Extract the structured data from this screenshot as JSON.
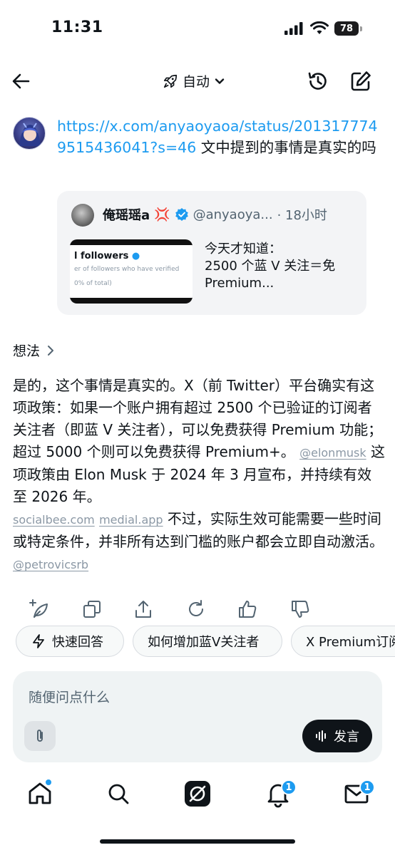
{
  "status_bar": {
    "time": "11:31",
    "battery": "78",
    "icons": [
      "signal-icon",
      "wifi-icon",
      "battery-icon"
    ]
  },
  "header": {
    "mode_label": "自动",
    "icons": [
      "back-arrow-icon",
      "rocket-icon",
      "chevron-down-icon",
      "history-icon",
      "compose-icon"
    ]
  },
  "user_message": {
    "link": "https://x.com/anyaoyaoa/status/2013177749515436041?s=46",
    "text": " 文中提到的事情是真实的吗"
  },
  "quoted_post": {
    "name": "俺瑶瑶a",
    "handle": "@anyaoya...",
    "time": "· 18小时",
    "thumbnail_title": "l followers",
    "thumbnail_sub": "er of followers who have verified",
    "thumbnail_foot": "0% of total)",
    "text_line1": "今天才知道：",
    "text_line2": "2500 个蓝 V 关注＝免",
    "text_line3": "Premium..."
  },
  "thoughts_label": "想法",
  "answer": {
    "p1": "是的，这个事情是真实的。X（前 Twitter）平台确实有这项政策：如果一个账户拥有超过 2500 个已验证的订阅者关注者（即蓝 V 关注者），可以免费获得 Premium 功能；超过 5000 个则可以免费获得 Premium+。 ",
    "cite1": "@elonmusk",
    "p2": " 这项政策由 Elon Musk 于 2024 年 3 月宣布，并持续有效至 2026 年。",
    "cite2": "socialbee.com",
    "cite3": "medial.app",
    "p3": " 不过，实际生效可能需要一些时间或特定条件，并非所有达到门槛的账户都会立即自动激活。 ",
    "cite4": "@petrovicsrb"
  },
  "action_icons": [
    "sparkle-leaf-icon",
    "copy-icon",
    "share-icon",
    "regenerate-icon",
    "thumbs-up-icon",
    "thumbs-down-icon"
  ],
  "chips": {
    "quick": "快速回答",
    "c2": "如何增加蓝V关注者",
    "c3": "X Premium订阅"
  },
  "composer": {
    "placeholder": "随便问点什么",
    "speak_label": "发言"
  },
  "tabbar": {
    "notifications_badge": "1",
    "messages_badge": "1",
    "icons": [
      "home-icon",
      "search-icon",
      "grok-icon",
      "bell-icon",
      "mail-icon"
    ]
  },
  "colors": {
    "link": "#1d9bf0",
    "text": "#0f1419",
    "muted": "#536471",
    "cite": "#8b98a5"
  }
}
